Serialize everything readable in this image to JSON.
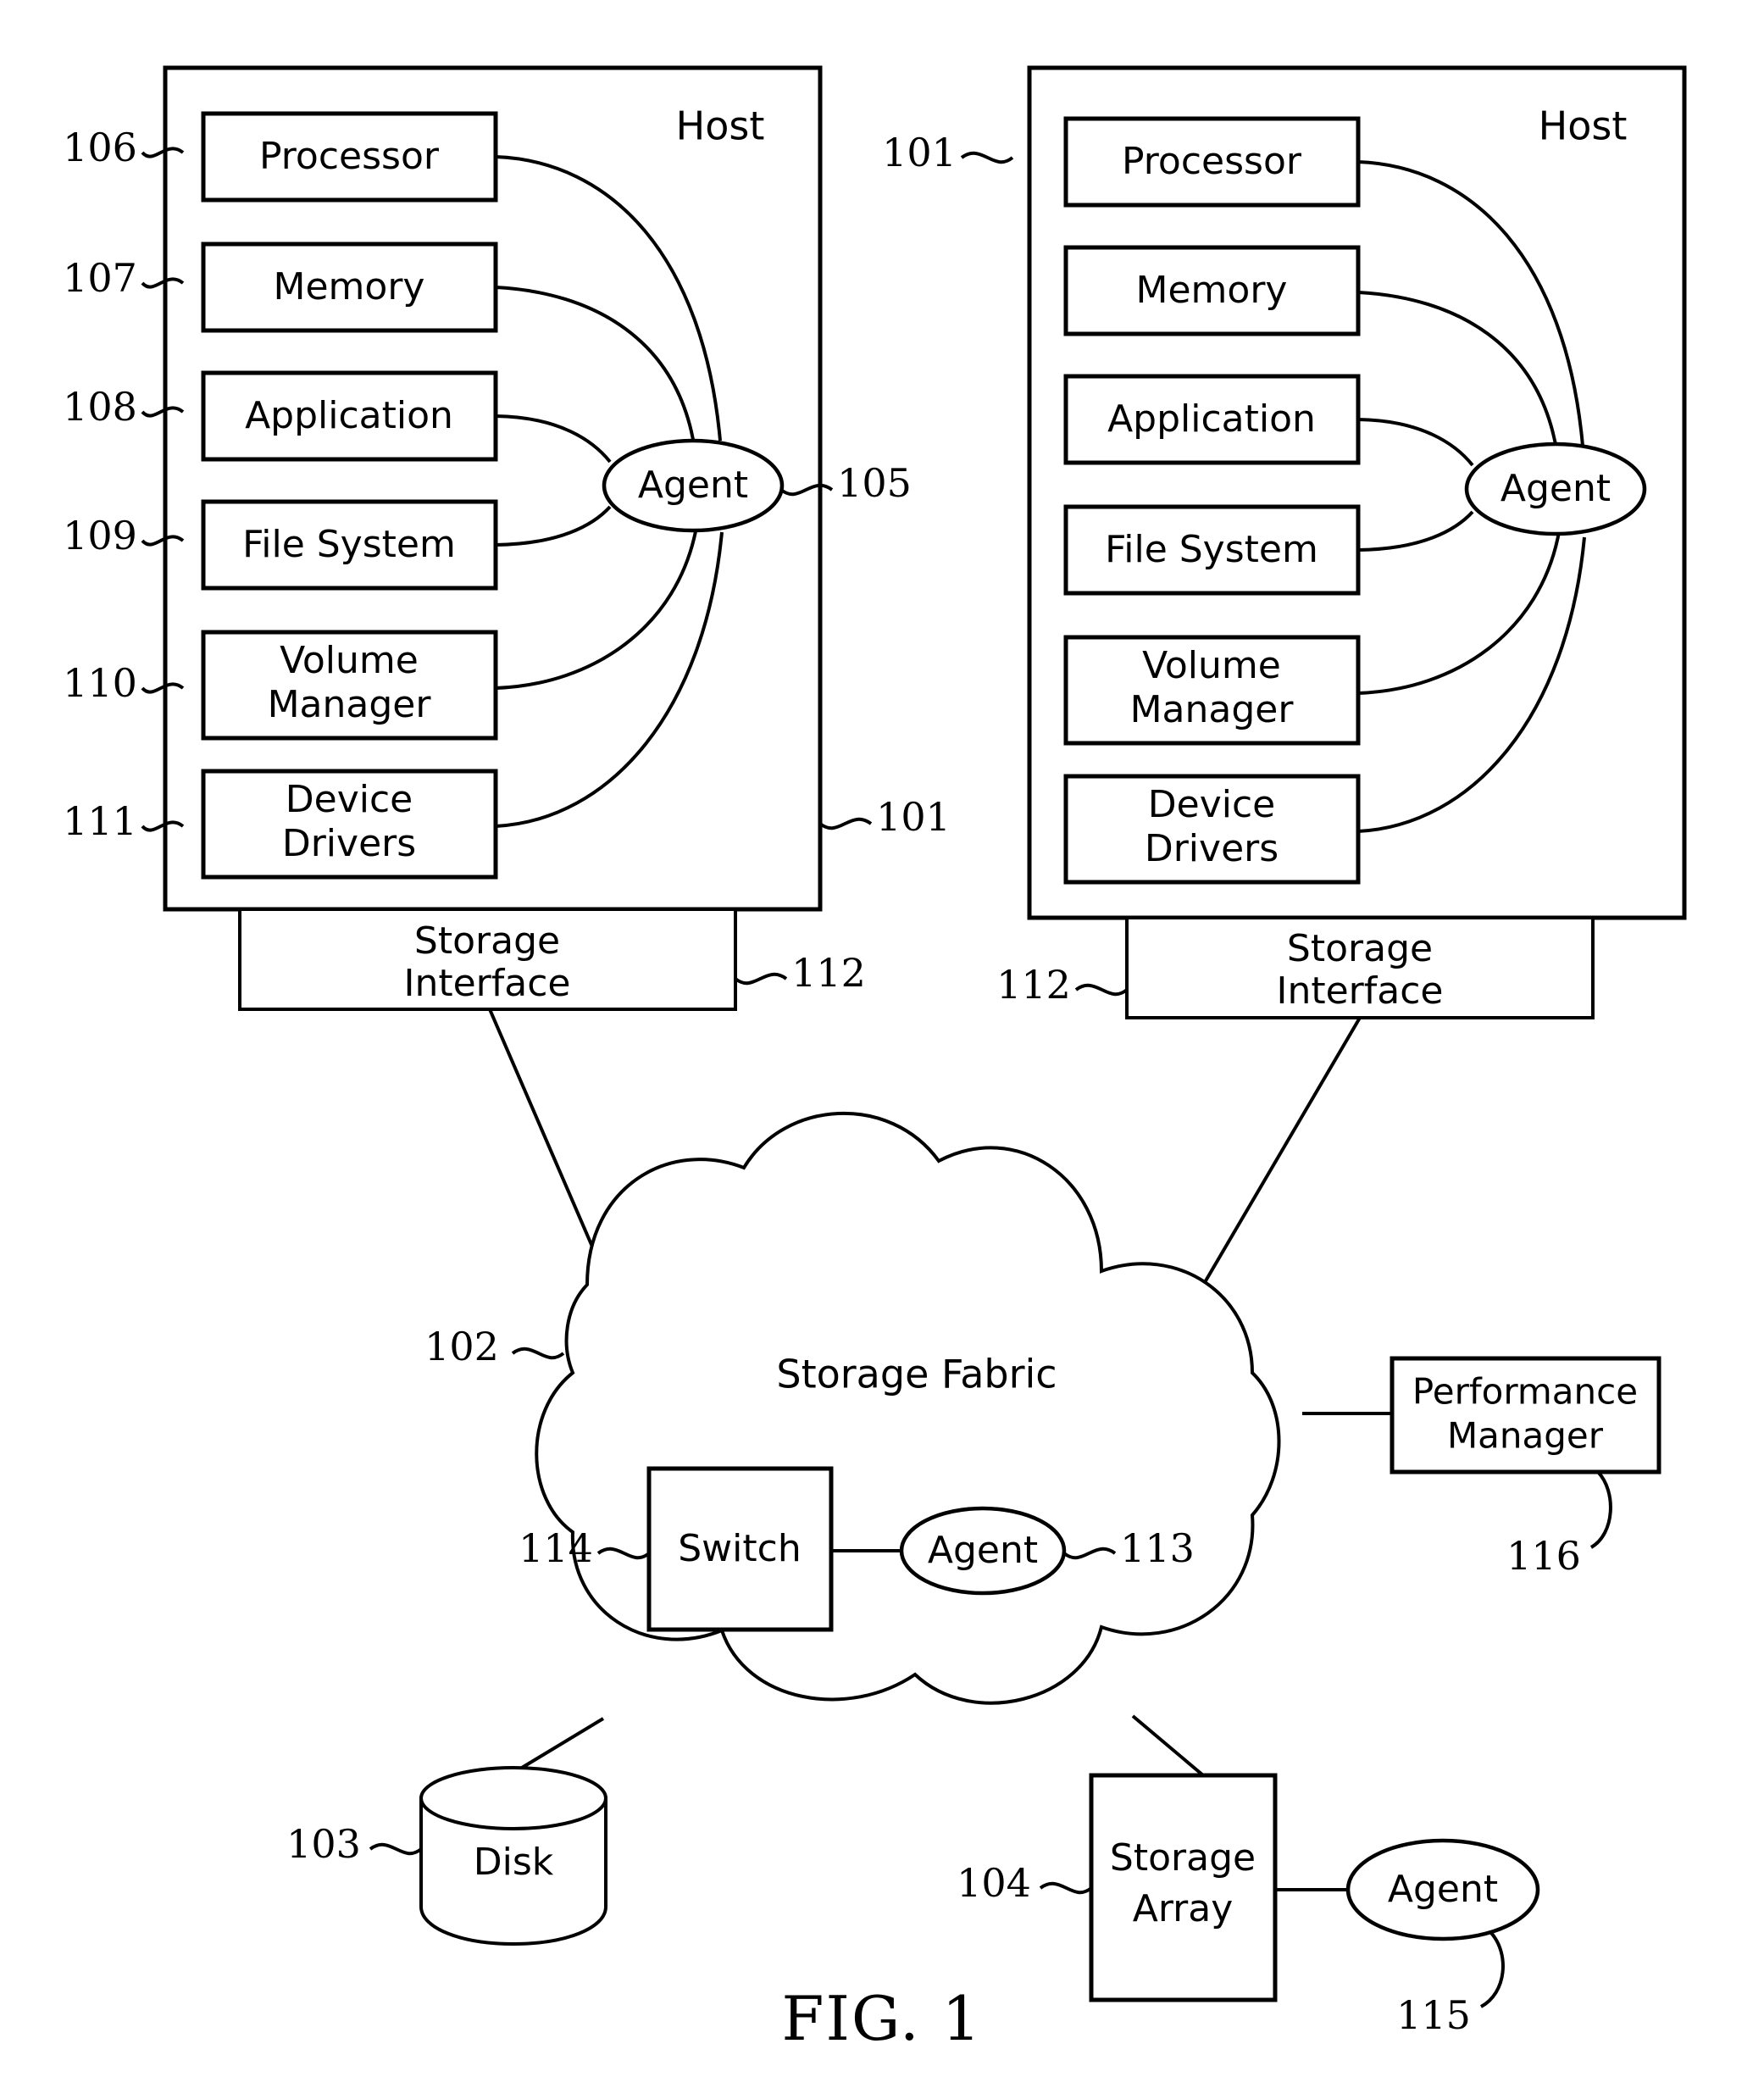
{
  "figure": {
    "caption": "FIG. 1"
  },
  "hosts": [
    {
      "id": "host-left",
      "title": "Host",
      "ref": "101",
      "components": [
        {
          "label": "Processor",
          "ref": "106"
        },
        {
          "label": "Memory",
          "ref": "107"
        },
        {
          "label": "Application",
          "ref": "108"
        },
        {
          "label": "File System",
          "ref": "109"
        },
        {
          "label": "Volume\nManager",
          "line1": "Volume",
          "line2": "Manager",
          "ref": "110"
        },
        {
          "label": "Device\nDrivers",
          "line1": "Device",
          "line2": "Drivers",
          "ref": "111"
        }
      ],
      "agent": {
        "label": "Agent",
        "ref": "105"
      },
      "storage_interface": {
        "line1": "Storage",
        "line2": "Interface",
        "ref": "112"
      }
    },
    {
      "id": "host-right",
      "title": "Host",
      "ref": "101",
      "components": [
        {
          "label": "Processor"
        },
        {
          "label": "Memory"
        },
        {
          "label": "Application"
        },
        {
          "label": "File System"
        },
        {
          "label": "Volume\nManager",
          "line1": "Volume",
          "line2": "Manager"
        },
        {
          "label": "Device\nDrivers",
          "line1": "Device",
          "line2": "Drivers"
        }
      ],
      "agent": {
        "label": "Agent"
      },
      "storage_interface": {
        "line1": "Storage",
        "line2": "Interface",
        "ref": "112"
      }
    }
  ],
  "fabric": {
    "title": "Storage Fabric",
    "ref": "102",
    "switch": {
      "label": "Switch",
      "ref": "114"
    },
    "agent": {
      "label": "Agent",
      "ref": "113"
    }
  },
  "performance_manager": {
    "line1": "Performance",
    "line2": "Manager",
    "ref": "116"
  },
  "disk": {
    "label": "Disk",
    "ref": "103"
  },
  "storage_array": {
    "line1": "Storage",
    "line2": "Array",
    "ref": "104",
    "agent": {
      "label": "Agent",
      "ref": "115"
    }
  },
  "colors": {
    "line": "#000000",
    "background": "#ffffff"
  }
}
